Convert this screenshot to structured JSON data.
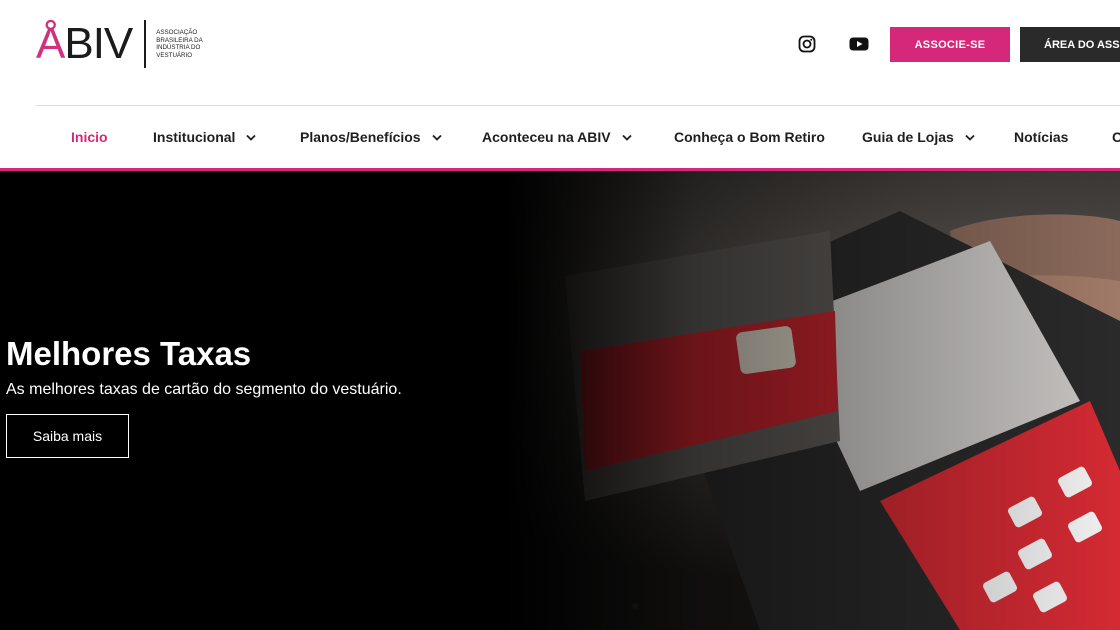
{
  "header": {
    "logo": {
      "letters_a": "Å",
      "letters_rest": "BIV",
      "subtitle": "ASSOCIAÇÃO BRASILEIRA DA INDÚSTRIA DO VESTUÁRIO"
    },
    "social": {
      "instagram_icon": "instagram-icon",
      "youtube_icon": "youtube-icon"
    },
    "associe_label": "ASSOCIE-SE",
    "area_label": "ÁREA DO ASSOCIADO"
  },
  "nav": {
    "items": [
      {
        "label": "Inicio",
        "active": true
      },
      {
        "label": "Institucional",
        "dropdown": true
      },
      {
        "label": "Planos/Benefícios",
        "dropdown": true
      },
      {
        "label": "Aconteceu na ABIV",
        "dropdown": true
      },
      {
        "label": "Conheça o Bom Retiro"
      },
      {
        "label": "Guia de Lojas",
        "dropdown": true
      },
      {
        "label": "Notícias"
      },
      {
        "label": "C"
      }
    ]
  },
  "hero": {
    "title": "Melhores Taxas",
    "subtitle": "As melhores taxas de cartão do segmento do vestuário.",
    "button_label": "Saiba mais"
  },
  "colors": {
    "accent": "#d6287a",
    "dark": "#2a2a2a"
  }
}
